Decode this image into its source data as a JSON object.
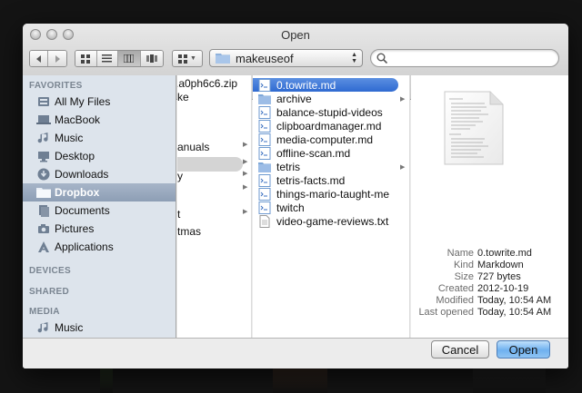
{
  "window": {
    "title": "Open"
  },
  "toolbar": {
    "back_icon": "back-arrow-icon",
    "forward_icon": "forward-arrow-icon",
    "view_modes": [
      "icon-view-icon",
      "list-view-icon",
      "column-view-icon",
      "coverflow-view-icon"
    ],
    "selected_view": "column-view-icon",
    "arrange_icon": "arrange-grid-icon",
    "path": "makeuseof",
    "search_placeholder": ""
  },
  "sidebar": {
    "favorites_header": "FAVORITES",
    "favorites": [
      {
        "label": "All My Files",
        "icon": "all-my-files-icon"
      },
      {
        "label": "MacBook",
        "icon": "laptop-icon"
      },
      {
        "label": "Music",
        "icon": "music-note-icon"
      },
      {
        "label": "Desktop",
        "icon": "desktop-icon"
      },
      {
        "label": "Downloads",
        "icon": "download-icon"
      },
      {
        "label": "Dropbox",
        "icon": "folder-icon",
        "selected": true
      },
      {
        "label": "Documents",
        "icon": "documents-icon"
      },
      {
        "label": "Pictures",
        "icon": "camera-icon"
      },
      {
        "label": "Applications",
        "icon": "applications-icon"
      }
    ],
    "devices_header": "DEVICES",
    "shared_header": "SHARED",
    "media_header": "MEDIA",
    "media": [
      {
        "label": "Music",
        "icon": "music-note-icon"
      }
    ]
  },
  "column1": {
    "items": [
      {
        "label": ".a0ph6c6.zip",
        "arrow": false
      },
      {
        "label": "ke",
        "arrow": false
      },
      {
        "label": "",
        "arrow": true,
        "selected": true
      },
      {
        "label": "anuals",
        "arrow": true
      },
      {
        "label": "",
        "arrow": true
      },
      {
        "label": "y",
        "arrow": true
      },
      {
        "label": "",
        "arrow": true
      },
      {
        "label": "",
        "arrow": false
      },
      {
        "label": "t",
        "arrow": true
      },
      {
        "label": "tmas",
        "arrow": false
      }
    ]
  },
  "column2": {
    "items": [
      {
        "label": "0.towrite.md",
        "icon": "markdown-file-icon",
        "selected": true
      },
      {
        "label": "archive",
        "icon": "folder-icon",
        "arrow": true
      },
      {
        "label": "balance-stupid-videos",
        "icon": "markdown-file-icon"
      },
      {
        "label": "clipboardmanager.md",
        "icon": "markdown-file-icon"
      },
      {
        "label": "media-computer.md",
        "icon": "markdown-file-icon"
      },
      {
        "label": "offline-scan.md",
        "icon": "markdown-file-icon"
      },
      {
        "label": "tetris",
        "icon": "folder-icon",
        "arrow": true
      },
      {
        "label": "tetris-facts.md",
        "icon": "markdown-file-icon"
      },
      {
        "label": "things-mario-taught-me",
        "icon": "markdown-file-icon"
      },
      {
        "label": "twitch",
        "icon": "markdown-file-icon"
      },
      {
        "label": "video-game-reviews.txt",
        "icon": "text-file-icon"
      }
    ]
  },
  "preview": {
    "thumbnail_icon": "document-preview-icon",
    "info": [
      {
        "key": "Name",
        "value": "0.towrite.md"
      },
      {
        "key": "Kind",
        "value": "Markdown"
      },
      {
        "key": "Size",
        "value": "727 bytes"
      },
      {
        "key": "Created",
        "value": "2012-10-19"
      },
      {
        "key": "Modified",
        "value": "Today, 10:54 AM"
      },
      {
        "key": "Last opened",
        "value": "Today, 10:54 AM"
      }
    ]
  },
  "footer": {
    "cancel_label": "Cancel",
    "open_label": "Open"
  },
  "colors": {
    "selection": "#3a74d6",
    "sidebar_bg": "#dde4ec",
    "sidebar_selection": "#98a8bd",
    "default_button": "#7db8f0"
  }
}
